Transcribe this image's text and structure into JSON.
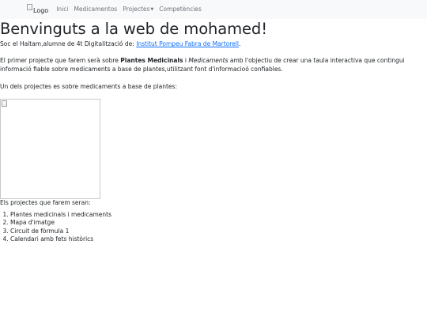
{
  "navbar": {
    "logo_alt": "Logo",
    "items": [
      {
        "label": "Inici"
      },
      {
        "label": "Medicamentos"
      },
      {
        "label": "Projectes",
        "has_dropdown": true
      },
      {
        "label": "Competències"
      }
    ]
  },
  "main": {
    "title": "Benvinguts a la web de mohamed!",
    "intro": {
      "text": "Soc el Haitam,alumne de 4t Digitalització de: ",
      "link_text": "Institut Pompeu Fabra de Martorell"
    },
    "paragraph1": {
      "part1": "El primer projecte que farem serà sobre ",
      "bold": "Plantes Medicinals",
      "part2": " i ",
      "italic": "Medicaments",
      "part3": " amb l'objectiu de crear una taula interactiva que contingui informació fiable sobre medicaments a base de plantes,utilitzant font d'informacioó confiables."
    },
    "paragraph2": "Un dels projectes es sobre medicaments a base de plantes:",
    "list_intro": "Els projectes que farem seran:",
    "projects": [
      "Plantes medicinals i medicaments",
      "Mapa d'imatge",
      "Circuit de fòrmula 1",
      "Calendari amb fets històrics"
    ]
  },
  "icons": {
    "logo": "broken-image-icon",
    "content_image": "broken-image-icon",
    "dropdown": "caret-down-icon"
  }
}
